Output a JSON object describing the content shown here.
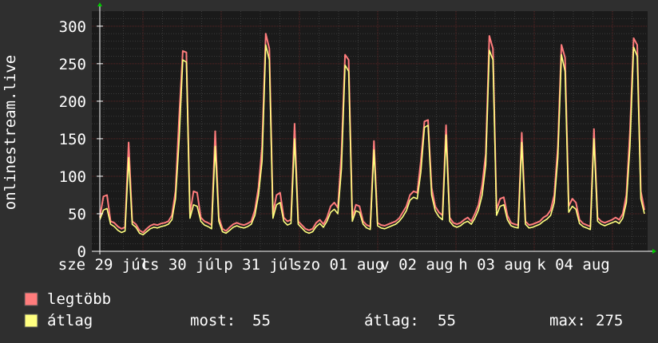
{
  "chart_data": {
    "type": "line",
    "ylabel": "onlinestream.live",
    "ylim": [
      0,
      320
    ],
    "y_ticks": [
      "0",
      "50",
      "100",
      "150",
      "200",
      "250",
      "300"
    ],
    "x_tick_labels": [
      "sze 29 júl",
      "cs 30 júl",
      "p 31 júl",
      "szo 01 aug",
      "v 02 aug",
      "h 03 aug",
      "k 04 aug"
    ],
    "grid": true,
    "background": "#1a1a1a",
    "grid_major_color": "#5a2424",
    "grid_minor_color": "#3a3a3a",
    "series": [
      {
        "name": "legtöbb",
        "color": "#ff7c7c",
        "peak_days": [
          0,
          1,
          2,
          3,
          4,
          5,
          6,
          7,
          8,
          9,
          10,
          11,
          12,
          13,
          14,
          15,
          16,
          17
        ],
        "peaks": [
          145,
          267,
          160,
          290,
          170,
          262,
          147,
          175,
          168,
          287,
          158,
          275,
          163,
          284
        ],
        "values": [
          45,
          73,
          75,
          40,
          38,
          33,
          30,
          32,
          145,
          40,
          36,
          28,
          25,
          30,
          34,
          36,
          35,
          37,
          38,
          40,
          48,
          80,
          180,
          267,
          265,
          50,
          80,
          78,
          45,
          40,
          38,
          35,
          160,
          45,
          30,
          27,
          32,
          36,
          38,
          36,
          35,
          37,
          40,
          55,
          85,
          140,
          290,
          270,
          50,
          75,
          78,
          45,
          40,
          42,
          170,
          40,
          35,
          30,
          28,
          30,
          38,
          42,
          36,
          45,
          60,
          65,
          58,
          130,
          262,
          255,
          45,
          62,
          60,
          40,
          35,
          33,
          147,
          38,
          35,
          34,
          36,
          38,
          40,
          44,
          52,
          60,
          75,
          80,
          78,
          120,
          173,
          175,
          85,
          60,
          52,
          48,
          168,
          45,
          38,
          36,
          38,
          42,
          45,
          40,
          50,
          62,
          88,
          130,
          287,
          270,
          55,
          70,
          72,
          48,
          38,
          36,
          35,
          158,
          40,
          35,
          36,
          38,
          40,
          45,
          48,
          55,
          75,
          140,
          275,
          258,
          60,
          70,
          65,
          42,
          37,
          35,
          33,
          163,
          45,
          40,
          38,
          40,
          42,
          45,
          42,
          50,
          75,
          160,
          284,
          275,
          80,
          55
        ]
      },
      {
        "name": "átlag",
        "color": "#ffff80",
        "values": [
          42,
          55,
          57,
          36,
          33,
          28,
          25,
          27,
          125,
          36,
          32,
          24,
          22,
          26,
          30,
          32,
          31,
          33,
          34,
          36,
          42,
          70,
          150,
          255,
          252,
          44,
          62,
          60,
          40,
          35,
          33,
          30,
          140,
          40,
          26,
          24,
          28,
          32,
          34,
          32,
          31,
          33,
          36,
          48,
          75,
          120,
          275,
          255,
          44,
          62,
          65,
          40,
          35,
          37,
          150,
          36,
          31,
          26,
          24,
          26,
          33,
          37,
          32,
          40,
          52,
          56,
          50,
          110,
          248,
          240,
          40,
          54,
          52,
          36,
          31,
          29,
          135,
          34,
          31,
          30,
          32,
          34,
          36,
          40,
          46,
          54,
          68,
          72,
          70,
          105,
          165,
          168,
          75,
          54,
          46,
          42,
          155,
          40,
          34,
          32,
          34,
          38,
          40,
          36,
          44,
          55,
          75,
          115,
          268,
          255,
          48,
          60,
          62,
          42,
          34,
          32,
          31,
          145,
          36,
          31,
          32,
          34,
          36,
          40,
          43,
          48,
          65,
          125,
          262,
          240,
          52,
          60,
          56,
          37,
          33,
          31,
          29,
          150,
          40,
          36,
          34,
          36,
          38,
          40,
          37,
          44,
          65,
          140,
          272,
          260,
          70,
          50
        ]
      }
    ],
    "legend": {
      "items": [
        {
          "label": "legtöbb",
          "color": "#ff7c7c"
        },
        {
          "label": "átlag",
          "color": "#ffff80"
        }
      ],
      "stats": {
        "most_label": "most:",
        "most_value": "55",
        "atlag_label": "átlag:",
        "atlag_value": "55",
        "max_label": "max:",
        "max_value": "275"
      }
    }
  }
}
